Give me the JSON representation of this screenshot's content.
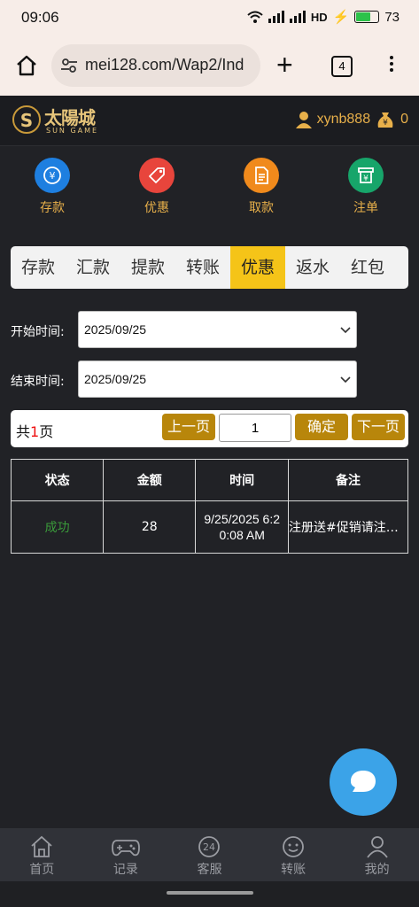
{
  "status_bar": {
    "time": "09:06",
    "network": "HD",
    "battery": "73"
  },
  "browser": {
    "url": "mei128.com/Wap2/Ind",
    "tab_count": "4"
  },
  "site": {
    "logo_text": "太陽城",
    "logo_sub": "SUN GAME",
    "username": "xynb888",
    "balance": "0"
  },
  "quick_actions": [
    {
      "label": "存款",
      "color": "#1e7fe0"
    },
    {
      "label": "优惠",
      "color": "#e8453c"
    },
    {
      "label": "取款",
      "color": "#f08a1c"
    },
    {
      "label": "注单",
      "color": "#17a56a"
    }
  ],
  "tabs": [
    "存款",
    "汇款",
    "提款",
    "转账",
    "优惠",
    "返水",
    "红包"
  ],
  "active_tab": "优惠",
  "filters": {
    "start_label": "开始时间:",
    "start_value": "2025/09/25",
    "end_label": "结束时间:",
    "end_value": "2025/09/25"
  },
  "pager": {
    "total_prefix": "共",
    "total_pages": "1",
    "total_suffix": "页",
    "prev": "上一页",
    "page_input": "1",
    "confirm": "确定",
    "next": "下一页"
  },
  "table": {
    "headers": [
      "状态",
      "金额",
      "时间",
      "备注"
    ],
    "rows": [
      {
        "status": "成功",
        "amount": "28",
        "time_line1": "9/25/2025 6:2",
        "time_line2": "0:08 AM",
        "note": "注册送#促销请注意..."
      }
    ]
  },
  "bottom_nav": [
    "首页",
    "记录",
    "客服",
    "转账",
    "我的"
  ],
  "colors": {
    "accent": "#f5c418",
    "gold": "#e8b04a",
    "button": "#b8860b",
    "success": "#3a9a3a",
    "fab": "#3ba3e8"
  }
}
